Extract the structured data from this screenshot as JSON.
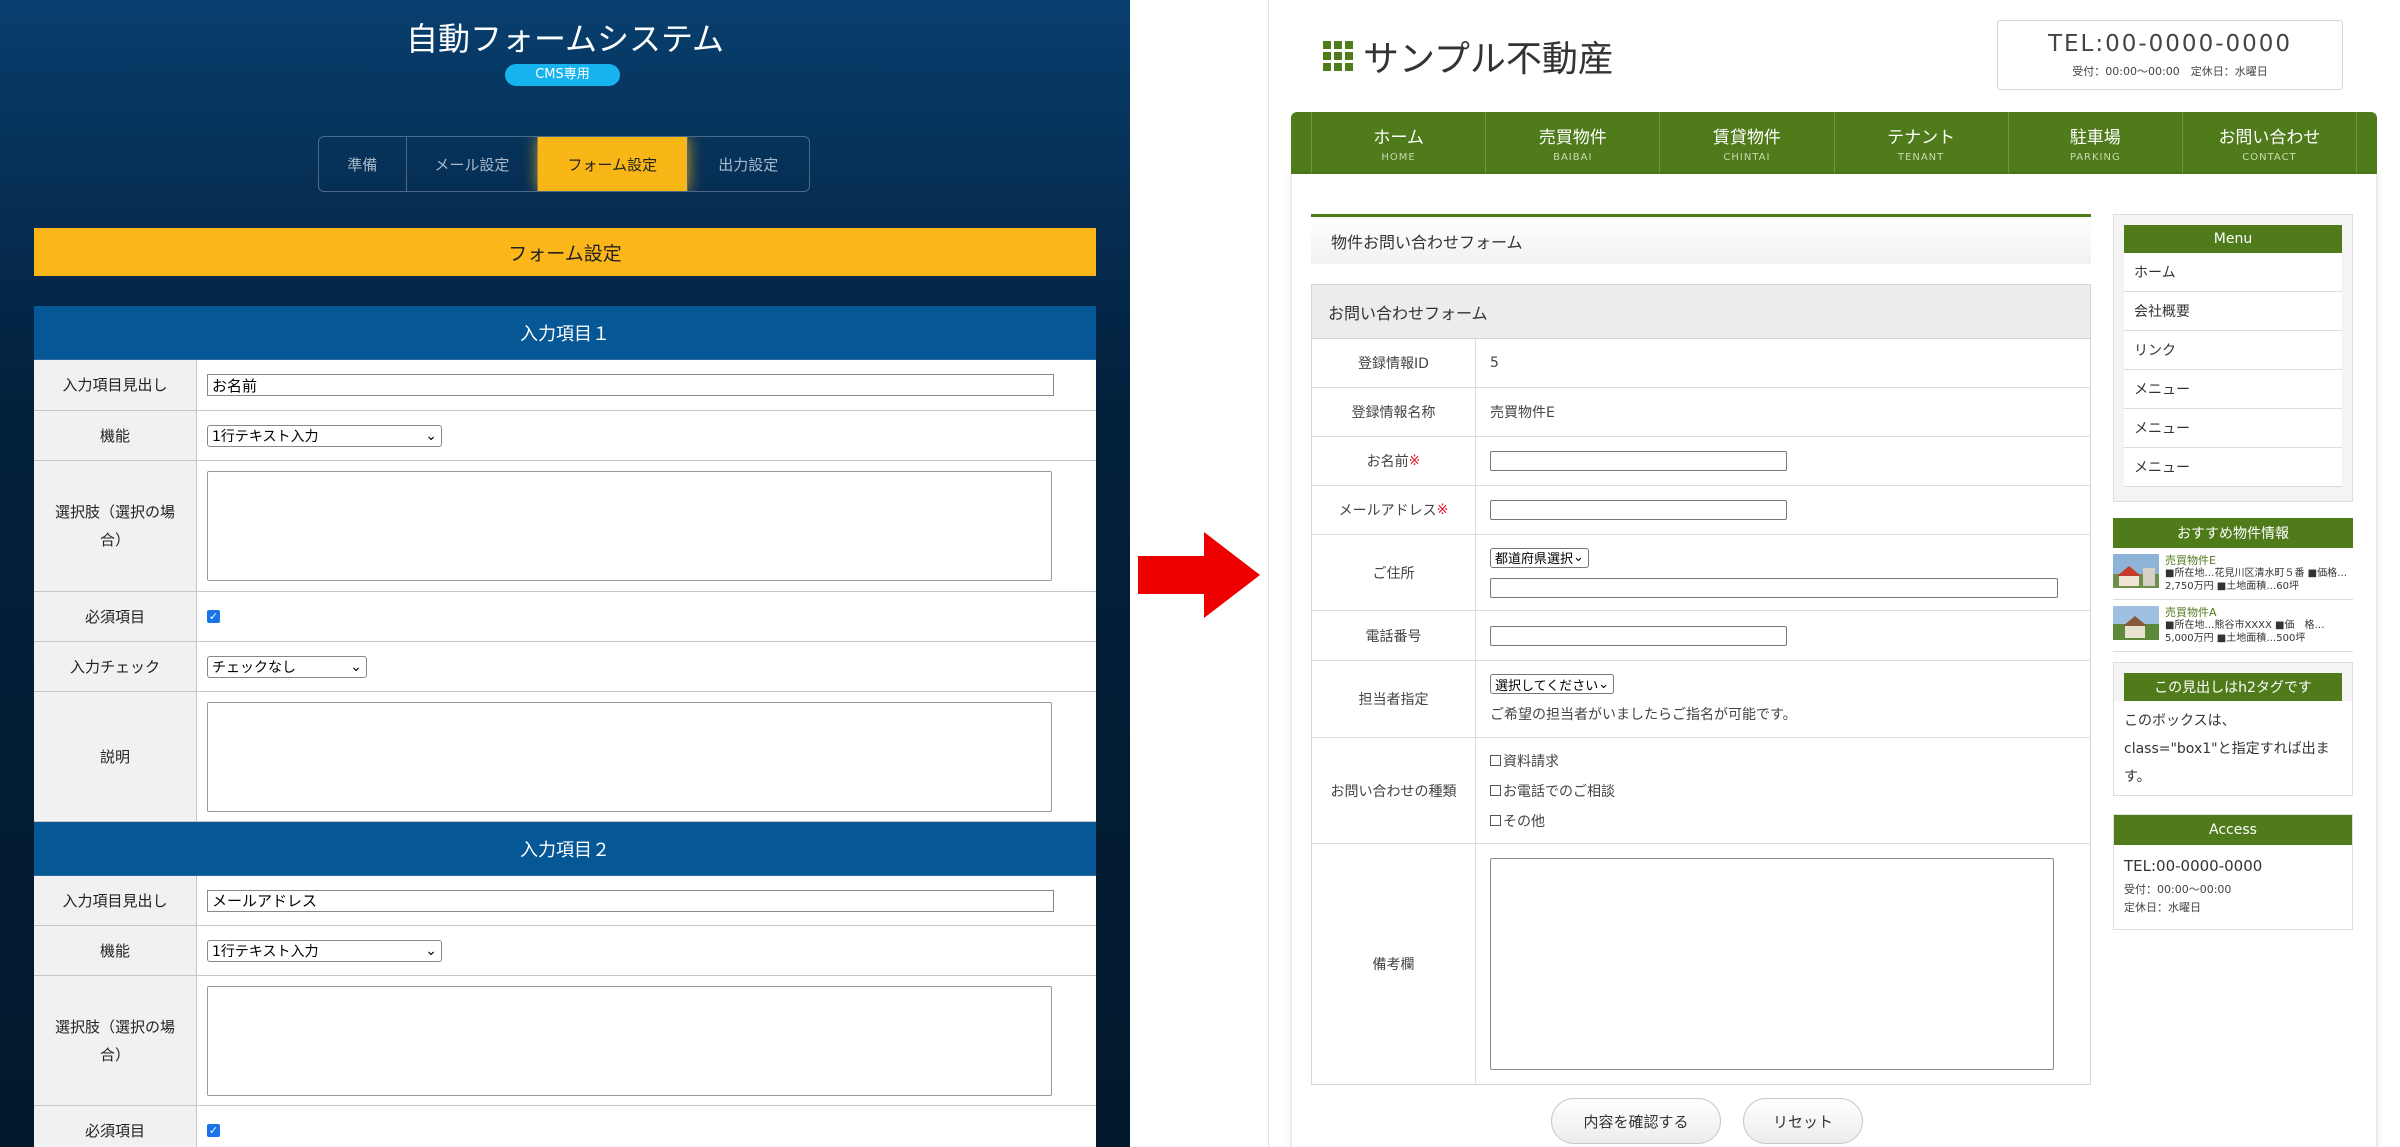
{
  "left": {
    "app_title": "自動フォームシステム",
    "badge": "CMS専用",
    "step_tabs": [
      "準備",
      "メール設定",
      "フォーム設定",
      "出力設定"
    ],
    "active_tab": "フォーム設定",
    "section_title": "フォーム設定",
    "items": [
      {
        "heading": "入力項目１",
        "labels": {
          "title": "入力項目見出し",
          "function": "機能",
          "choices": "選択肢（選択の場合）",
          "required": "必須項目",
          "check": "入力チェック",
          "description": "説明"
        },
        "title_value": "お名前",
        "function_value": "1行テキスト入力",
        "required_checked": true,
        "check_value": "チェックなし"
      },
      {
        "heading": "入力項目２",
        "labels": {
          "title": "入力項目見出し",
          "function": "機能",
          "choices": "選択肢（選択の場合）",
          "required": "必須項目"
        },
        "title_value": "メールアドレス",
        "function_value": "1行テキスト入力",
        "required_checked": true
      }
    ]
  },
  "right": {
    "site_name": "サンプル不動産",
    "tel": "TEL:00-0000-0000",
    "tel_hours": "受付：00:00〜00:00　定休日：水曜日",
    "nav": [
      {
        "jp": "ホーム",
        "en": "HOME"
      },
      {
        "jp": "売買物件",
        "en": "BAIBAI"
      },
      {
        "jp": "賃貸物件",
        "en": "CHINTAI"
      },
      {
        "jp": "テナント",
        "en": "TENANT"
      },
      {
        "jp": "駐車場",
        "en": "PARKING"
      },
      {
        "jp": "お問い合わせ",
        "en": "CONTACT"
      }
    ],
    "page_heading": "物件お問い合わせフォーム",
    "form": {
      "title": "お問い合わせフォーム",
      "reg_id_label": "登録情報ID",
      "reg_id_value": "5",
      "reg_name_label": "登録情報名称",
      "reg_name_value": "売買物件E",
      "name_label": "お名前",
      "email_label": "メールアドレス",
      "required_mark": "※",
      "address_label": "ご住所",
      "pref_select": "都道府県選択",
      "phone_label": "電話番号",
      "staff_label": "担当者指定",
      "staff_select": "選択してください",
      "staff_note": "ご希望の担当者がいましたらご指名が可能です。",
      "type_label": "お問い合わせの種類",
      "type_options": [
        "資料請求",
        "お電話でのご相談",
        "その他"
      ],
      "remarks_label": "備考欄",
      "confirm_button": "内容を確認する",
      "reset_button": "リセット"
    },
    "sidebar": {
      "menu_title": "Menu",
      "menu_items": [
        "ホーム",
        "会社概要",
        "リンク",
        "メニュー",
        "メニュー",
        "メニュー"
      ],
      "recommend_title": "おすすめ物件情報",
      "recommend": [
        {
          "title": "売買物件E",
          "desc": "■所在地…花見川区清水町５番 ■価格…2,750万円 ■土地面積…60坪"
        },
        {
          "title": "売買物件A",
          "desc": "■所在地…熊谷市XXXX ■価　格…5,000万円 ■土地面積…500坪"
        }
      ],
      "h2_title": "この見出しはh2タグです",
      "h2_text": "このボックスは、class=\"box1\"と指定すれば出ます。",
      "access_title": "Access",
      "access_tel": "TEL:00-0000-0000",
      "access_hours": "受付：00:00〜00:00",
      "access_closed": "定休日：水曜日"
    }
  },
  "colors": {
    "left_bg": "#062f55",
    "accent_yellow": "#fbb719",
    "item_header_blue": "#055795",
    "site_green": "#4f7b1b",
    "arrow_red": "#ee0000",
    "required_red": "#e0202a"
  }
}
